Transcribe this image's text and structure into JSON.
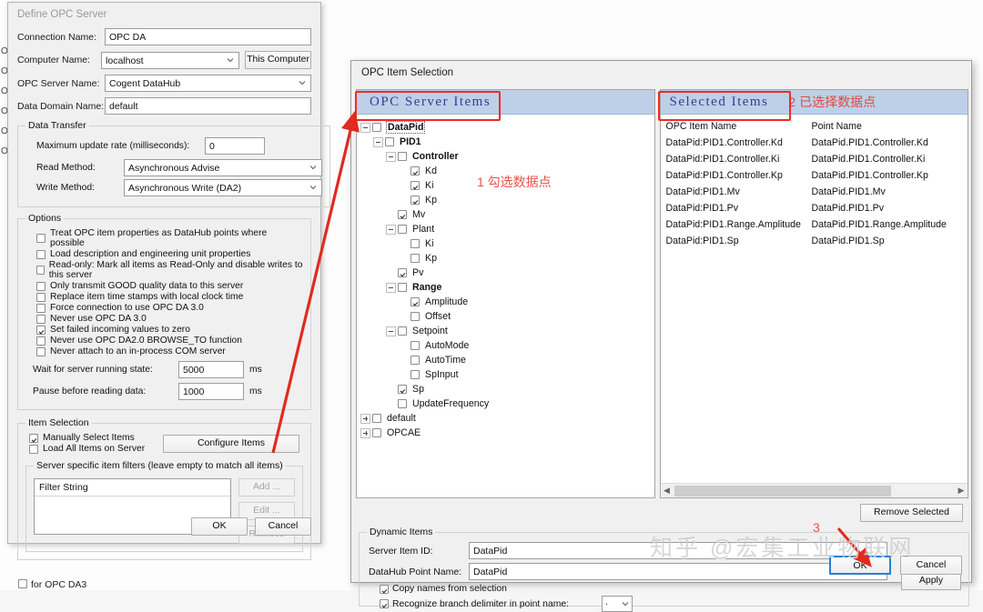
{
  "background": {
    "left_list": [
      "O",
      "O",
      "O",
      "O",
      "O",
      "O"
    ],
    "bottom_checkbox_label": "for OPC DA3"
  },
  "define_window": {
    "title": "Define OPC Server",
    "fields": [
      {
        "label": "Connection Name:",
        "value": "OPC DA",
        "type": "text"
      },
      {
        "label": "Computer Name:",
        "value": "localhost",
        "type": "combo"
      },
      {
        "label": "OPC Server Name:",
        "value": "Cogent DataHub",
        "type": "combo"
      },
      {
        "label": "Data Domain Name:",
        "value": "default",
        "type": "text"
      }
    ],
    "this_computer_button": "This Computer",
    "data_transfer": {
      "legend": "Data Transfer",
      "max_update_label": "Maximum update rate (milliseconds):",
      "max_update_value": "0",
      "read_method_label": "Read Method:",
      "read_method_value": "Asynchronous Advise",
      "write_method_label": "Write Method:",
      "write_method_value": "Asynchronous Write (DA2)"
    },
    "options": {
      "legend": "Options",
      "items": [
        {
          "label": "Treat OPC item properties as DataHub points where possible",
          "checked": false
        },
        {
          "label": "Load description and engineering unit properties",
          "checked": false
        },
        {
          "label": "Read-only: Mark all items as Read-Only and disable writes to this server",
          "checked": false
        },
        {
          "label": "Only transmit GOOD quality data to this server",
          "checked": false
        },
        {
          "label": "Replace item time stamps with local clock time",
          "checked": false
        },
        {
          "label": "Force connection to use OPC DA 3.0",
          "checked": false
        },
        {
          "label": "Never use OPC DA 3.0",
          "checked": false
        },
        {
          "label": "Set failed incoming values to zero",
          "checked": true
        },
        {
          "label": "Never use OPC DA2.0 BROWSE_TO function",
          "checked": false
        },
        {
          "label": "Never attach to an in-process COM server",
          "checked": false
        }
      ],
      "wait_label": "Wait for server running state:",
      "wait_value": "5000",
      "wait_unit": "ms",
      "pause_label": "Pause before reading data:",
      "pause_value": "1000",
      "pause_unit": "ms"
    },
    "item_selection": {
      "legend": "Item Selection",
      "manually_select_label": "Manually Select Items",
      "manually_select_checked": true,
      "load_all_label": "Load All Items on Server",
      "load_all_checked": false,
      "configure_items_button": "Configure Items",
      "filters_legend": "Server specific item filters (leave empty to match all items)",
      "filter_header": "Filter String",
      "add_button": "Add ...",
      "edit_button": "Edit ...",
      "remove_button": "Remove"
    },
    "ok_button": "OK",
    "cancel_button": "Cancel"
  },
  "item_dialog": {
    "title": "OPC Item Selection",
    "left_header": "OPC Server Items",
    "right_header": "Selected Items",
    "right_header_annotation": "2 已选择数据点",
    "tree": [
      {
        "label": "DataPid",
        "depth": 0,
        "expander": "minus",
        "checked": false,
        "bold": true,
        "selected": true
      },
      {
        "label": "PID1",
        "depth": 1,
        "expander": "minus",
        "checked": false,
        "bold": true,
        "selected": false
      },
      {
        "label": "Controller",
        "depth": 2,
        "expander": "minus",
        "checked": false,
        "bold": true,
        "selected": false
      },
      {
        "label": "Kd",
        "depth": 3,
        "expander": "none",
        "checked": true,
        "bold": false,
        "selected": false
      },
      {
        "label": "Ki",
        "depth": 3,
        "expander": "none",
        "checked": true,
        "bold": false,
        "selected": false
      },
      {
        "label": "Kp",
        "depth": 3,
        "expander": "none",
        "checked": true,
        "bold": false,
        "selected": false
      },
      {
        "label": "Mv",
        "depth": 2,
        "expander": "none",
        "checked": true,
        "bold": false,
        "selected": false
      },
      {
        "label": "Plant",
        "depth": 2,
        "expander": "minus",
        "checked": false,
        "bold": false,
        "selected": false
      },
      {
        "label": "Ki",
        "depth": 3,
        "expander": "none",
        "checked": false,
        "bold": false,
        "selected": false
      },
      {
        "label": "Kp",
        "depth": 3,
        "expander": "none",
        "checked": false,
        "bold": false,
        "selected": false
      },
      {
        "label": "Pv",
        "depth": 2,
        "expander": "none",
        "checked": true,
        "bold": false,
        "selected": false
      },
      {
        "label": "Range",
        "depth": 2,
        "expander": "minus",
        "checked": false,
        "bold": true,
        "selected": false
      },
      {
        "label": "Amplitude",
        "depth": 3,
        "expander": "none",
        "checked": true,
        "bold": false,
        "selected": false
      },
      {
        "label": "Offset",
        "depth": 3,
        "expander": "none",
        "checked": false,
        "bold": false,
        "selected": false
      },
      {
        "label": "Setpoint",
        "depth": 2,
        "expander": "minus",
        "checked": false,
        "bold": false,
        "selected": false
      },
      {
        "label": "AutoMode",
        "depth": 3,
        "expander": "none",
        "checked": false,
        "bold": false,
        "selected": false
      },
      {
        "label": "AutoTime",
        "depth": 3,
        "expander": "none",
        "checked": false,
        "bold": false,
        "selected": false
      },
      {
        "label": "SpInput",
        "depth": 3,
        "expander": "none",
        "checked": false,
        "bold": false,
        "selected": false
      },
      {
        "label": "Sp",
        "depth": 2,
        "expander": "none",
        "checked": true,
        "bold": false,
        "selected": false
      },
      {
        "label": "UpdateFrequency",
        "depth": 2,
        "expander": "none",
        "checked": false,
        "bold": false,
        "selected": false
      },
      {
        "label": "default",
        "depth": 0,
        "expander": "plus",
        "checked": false,
        "bold": false,
        "selected": false
      },
      {
        "label": "OPCAE",
        "depth": 0,
        "expander": "plus",
        "checked": false,
        "bold": false,
        "selected": false
      }
    ],
    "selected_columns": [
      "OPC Item Name",
      "Point Name"
    ],
    "selected_rows": [
      [
        "DataPid:PID1.Controller.Kd",
        "DataPid.PID1.Controller.Kd"
      ],
      [
        "DataPid:PID1.Controller.Ki",
        "DataPid.PID1.Controller.Ki"
      ],
      [
        "DataPid:PID1.Controller.Kp",
        "DataPid.PID1.Controller.Kp"
      ],
      [
        "DataPid:PID1.Mv",
        "DataPid.PID1.Mv"
      ],
      [
        "DataPid:PID1.Pv",
        "DataPid.PID1.Pv"
      ],
      [
        "DataPid:PID1.Range.Amplitude",
        "DataPid.PID1.Range.Amplitude"
      ],
      [
        "DataPid:PID1.Sp",
        "DataPid.PID1.Sp"
      ]
    ],
    "remove_selected_button": "Remove Selected",
    "dynamic_items": {
      "legend": "Dynamic Items",
      "server_item_id_label": "Server Item ID:",
      "server_item_id_value": "DataPid",
      "point_name_label": "DataHub Point Name:",
      "point_name_value": "DataPid",
      "apply_button": "Apply",
      "copy_names_label": "Copy names from selection",
      "copy_names_checked": true,
      "recognize_label": "Recognize branch delimiter in point name:",
      "recognize_checked": true,
      "delimiter_value": "."
    },
    "ok_button": "OK",
    "cancel_button": "Cancel"
  },
  "annotations": {
    "step1": "1 勾选数据点",
    "step3": "3"
  },
  "watermark": "知乎 @宏集工业物联网",
  "colors": {
    "annotation_red": "#ee2b22",
    "panel_header_blue": "#bdd0e8",
    "header_text_blue": "#30408f",
    "default_button_border": "#2a7fd4"
  }
}
